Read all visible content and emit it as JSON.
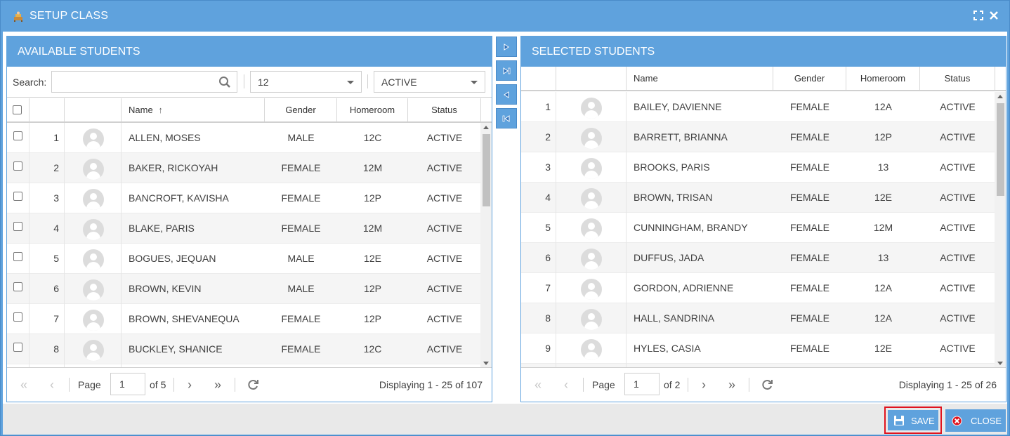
{
  "window": {
    "title": "SETUP CLASS"
  },
  "available": {
    "title": "AVAILABLE STUDENTS",
    "search_label": "Search:",
    "search_value": "",
    "grade_select": "12",
    "status_select": "ACTIVE",
    "columns": {
      "name": "Name",
      "gender": "Gender",
      "homeroom": "Homeroom",
      "status": "Status"
    },
    "sort_indicator": "↑",
    "rows": [
      {
        "num": "1",
        "name": "ALLEN, MOSES",
        "gender": "MALE",
        "homeroom": "12C",
        "status": "ACTIVE"
      },
      {
        "num": "2",
        "name": "BAKER, RICKOYAH",
        "gender": "FEMALE",
        "homeroom": "12M",
        "status": "ACTIVE"
      },
      {
        "num": "3",
        "name": "BANCROFT, KAVISHA",
        "gender": "FEMALE",
        "homeroom": "12P",
        "status": "ACTIVE"
      },
      {
        "num": "4",
        "name": "BLAKE, PARIS",
        "gender": "FEMALE",
        "homeroom": "12M",
        "status": "ACTIVE"
      },
      {
        "num": "5",
        "name": "BOGUES, JEQUAN",
        "gender": "MALE",
        "homeroom": "12E",
        "status": "ACTIVE"
      },
      {
        "num": "6",
        "name": "BROWN, KEVIN",
        "gender": "MALE",
        "homeroom": "12P",
        "status": "ACTIVE"
      },
      {
        "num": "7",
        "name": "BROWN, SHEVANEQUA",
        "gender": "FEMALE",
        "homeroom": "12P",
        "status": "ACTIVE"
      },
      {
        "num": "8",
        "name": "BUCKLEY, SHANICE",
        "gender": "FEMALE",
        "homeroom": "12C",
        "status": "ACTIVE"
      }
    ],
    "pager": {
      "page_label": "Page",
      "page_value": "1",
      "of_label": "of 5",
      "display": "Displaying 1 - 25 of 107"
    }
  },
  "selected": {
    "title": "SELECTED STUDENTS",
    "columns": {
      "name": "Name",
      "gender": "Gender",
      "homeroom": "Homeroom",
      "status": "Status"
    },
    "rows": [
      {
        "num": "1",
        "name": "BAILEY, DAVIENNE",
        "gender": "FEMALE",
        "homeroom": "12A",
        "status": "ACTIVE"
      },
      {
        "num": "2",
        "name": "BARRETT, BRIANNA",
        "gender": "FEMALE",
        "homeroom": "12P",
        "status": "ACTIVE"
      },
      {
        "num": "3",
        "name": "BROOKS, PARIS",
        "gender": "FEMALE",
        "homeroom": "13",
        "status": "ACTIVE"
      },
      {
        "num": "4",
        "name": "BROWN, TRISAN",
        "gender": "FEMALE",
        "homeroom": "12E",
        "status": "ACTIVE"
      },
      {
        "num": "5",
        "name": "CUNNINGHAM, BRANDY",
        "gender": "FEMALE",
        "homeroom": "12M",
        "status": "ACTIVE"
      },
      {
        "num": "6",
        "name": "DUFFUS, JADA",
        "gender": "FEMALE",
        "homeroom": "13",
        "status": "ACTIVE"
      },
      {
        "num": "7",
        "name": "GORDON, ADRIENNE",
        "gender": "FEMALE",
        "homeroom": "12A",
        "status": "ACTIVE"
      },
      {
        "num": "8",
        "name": "HALL, SANDRINA",
        "gender": "FEMALE",
        "homeroom": "12A",
        "status": "ACTIVE"
      },
      {
        "num": "9",
        "name": "HYLES, CASIA",
        "gender": "FEMALE",
        "homeroom": "12E",
        "status": "ACTIVE"
      }
    ],
    "pager": {
      "page_label": "Page",
      "page_value": "1",
      "of_label": "of 2",
      "display": "Displaying 1 - 25 of 26"
    }
  },
  "footer": {
    "save_label": "SAVE",
    "close_label": "CLOSE"
  },
  "colors": {
    "accent": "#5fa2dd",
    "highlight": "#e0141e"
  }
}
